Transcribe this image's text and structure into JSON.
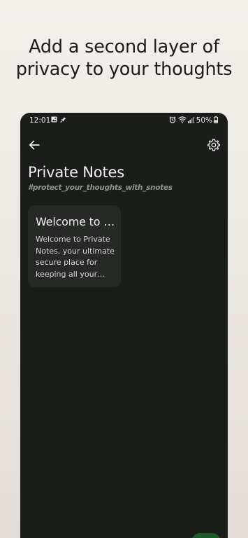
{
  "headline": {
    "line1": "Add a second layer of",
    "line2": "privacy to your thoughts"
  },
  "statusbar": {
    "time": "12:01",
    "battery": "50%",
    "icons": [
      "image-icon",
      "pin-icon",
      "alarm-icon",
      "wifi-icon",
      "signal-icon",
      "battery-icon"
    ]
  },
  "appbar": {
    "back_icon": "arrow-left-icon",
    "settings_icon": "gear-icon"
  },
  "page": {
    "title": "Private Notes",
    "tagline": "#protect_your_thoughts_with_snotes"
  },
  "notes": [
    {
      "title": "Welcome to Private Notes",
      "body": "Welcome to Private Notes, your ultimate secure place for keeping all your content private."
    }
  ],
  "colors": {
    "background": "#ece8e4",
    "phone_screen": "#1b1d1b",
    "card": "#262926",
    "fab": "#1f5a2a"
  }
}
